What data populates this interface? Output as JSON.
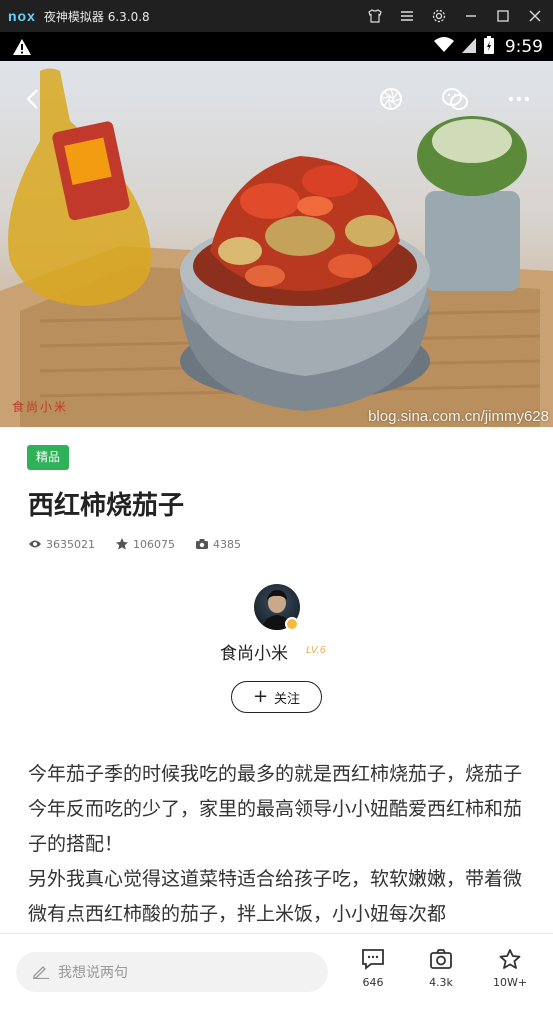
{
  "emulator": {
    "logo": "nox",
    "title": "夜神模拟器 6.3.0.8"
  },
  "status_bar": {
    "time": "9:59"
  },
  "hero": {
    "watermark": "blog.sina.com.cn/jimmy628",
    "corner_text": "食尚小米"
  },
  "recipe": {
    "badge": "精品",
    "title": "西红柿烧茄子",
    "views": "3635021",
    "favorites": "106075",
    "photos": "4385"
  },
  "author": {
    "name": "食尚小米",
    "level": "LV.6",
    "follow_label": "关注"
  },
  "description": [
    "今年茄子季的时候我吃的最多的就是西红柿烧茄子，烧茄子今年反而吃的少了，家里的最高领导小小妞酷爱西红柿和茄子的搭配！",
    "另外我真心觉得这道菜特适合给孩子吃，软软嫩嫩，带着微微有点西红柿酸的茄子，拌上米饭，小小妞每次都"
  ],
  "bottom_bar": {
    "comment_placeholder": "我想说两句",
    "comments_count": "646",
    "photos_count": "4.3k",
    "favorites_count": "10W+"
  },
  "colors": {
    "badge_green": "#2fb257",
    "level_gold": "#e2b35a"
  }
}
